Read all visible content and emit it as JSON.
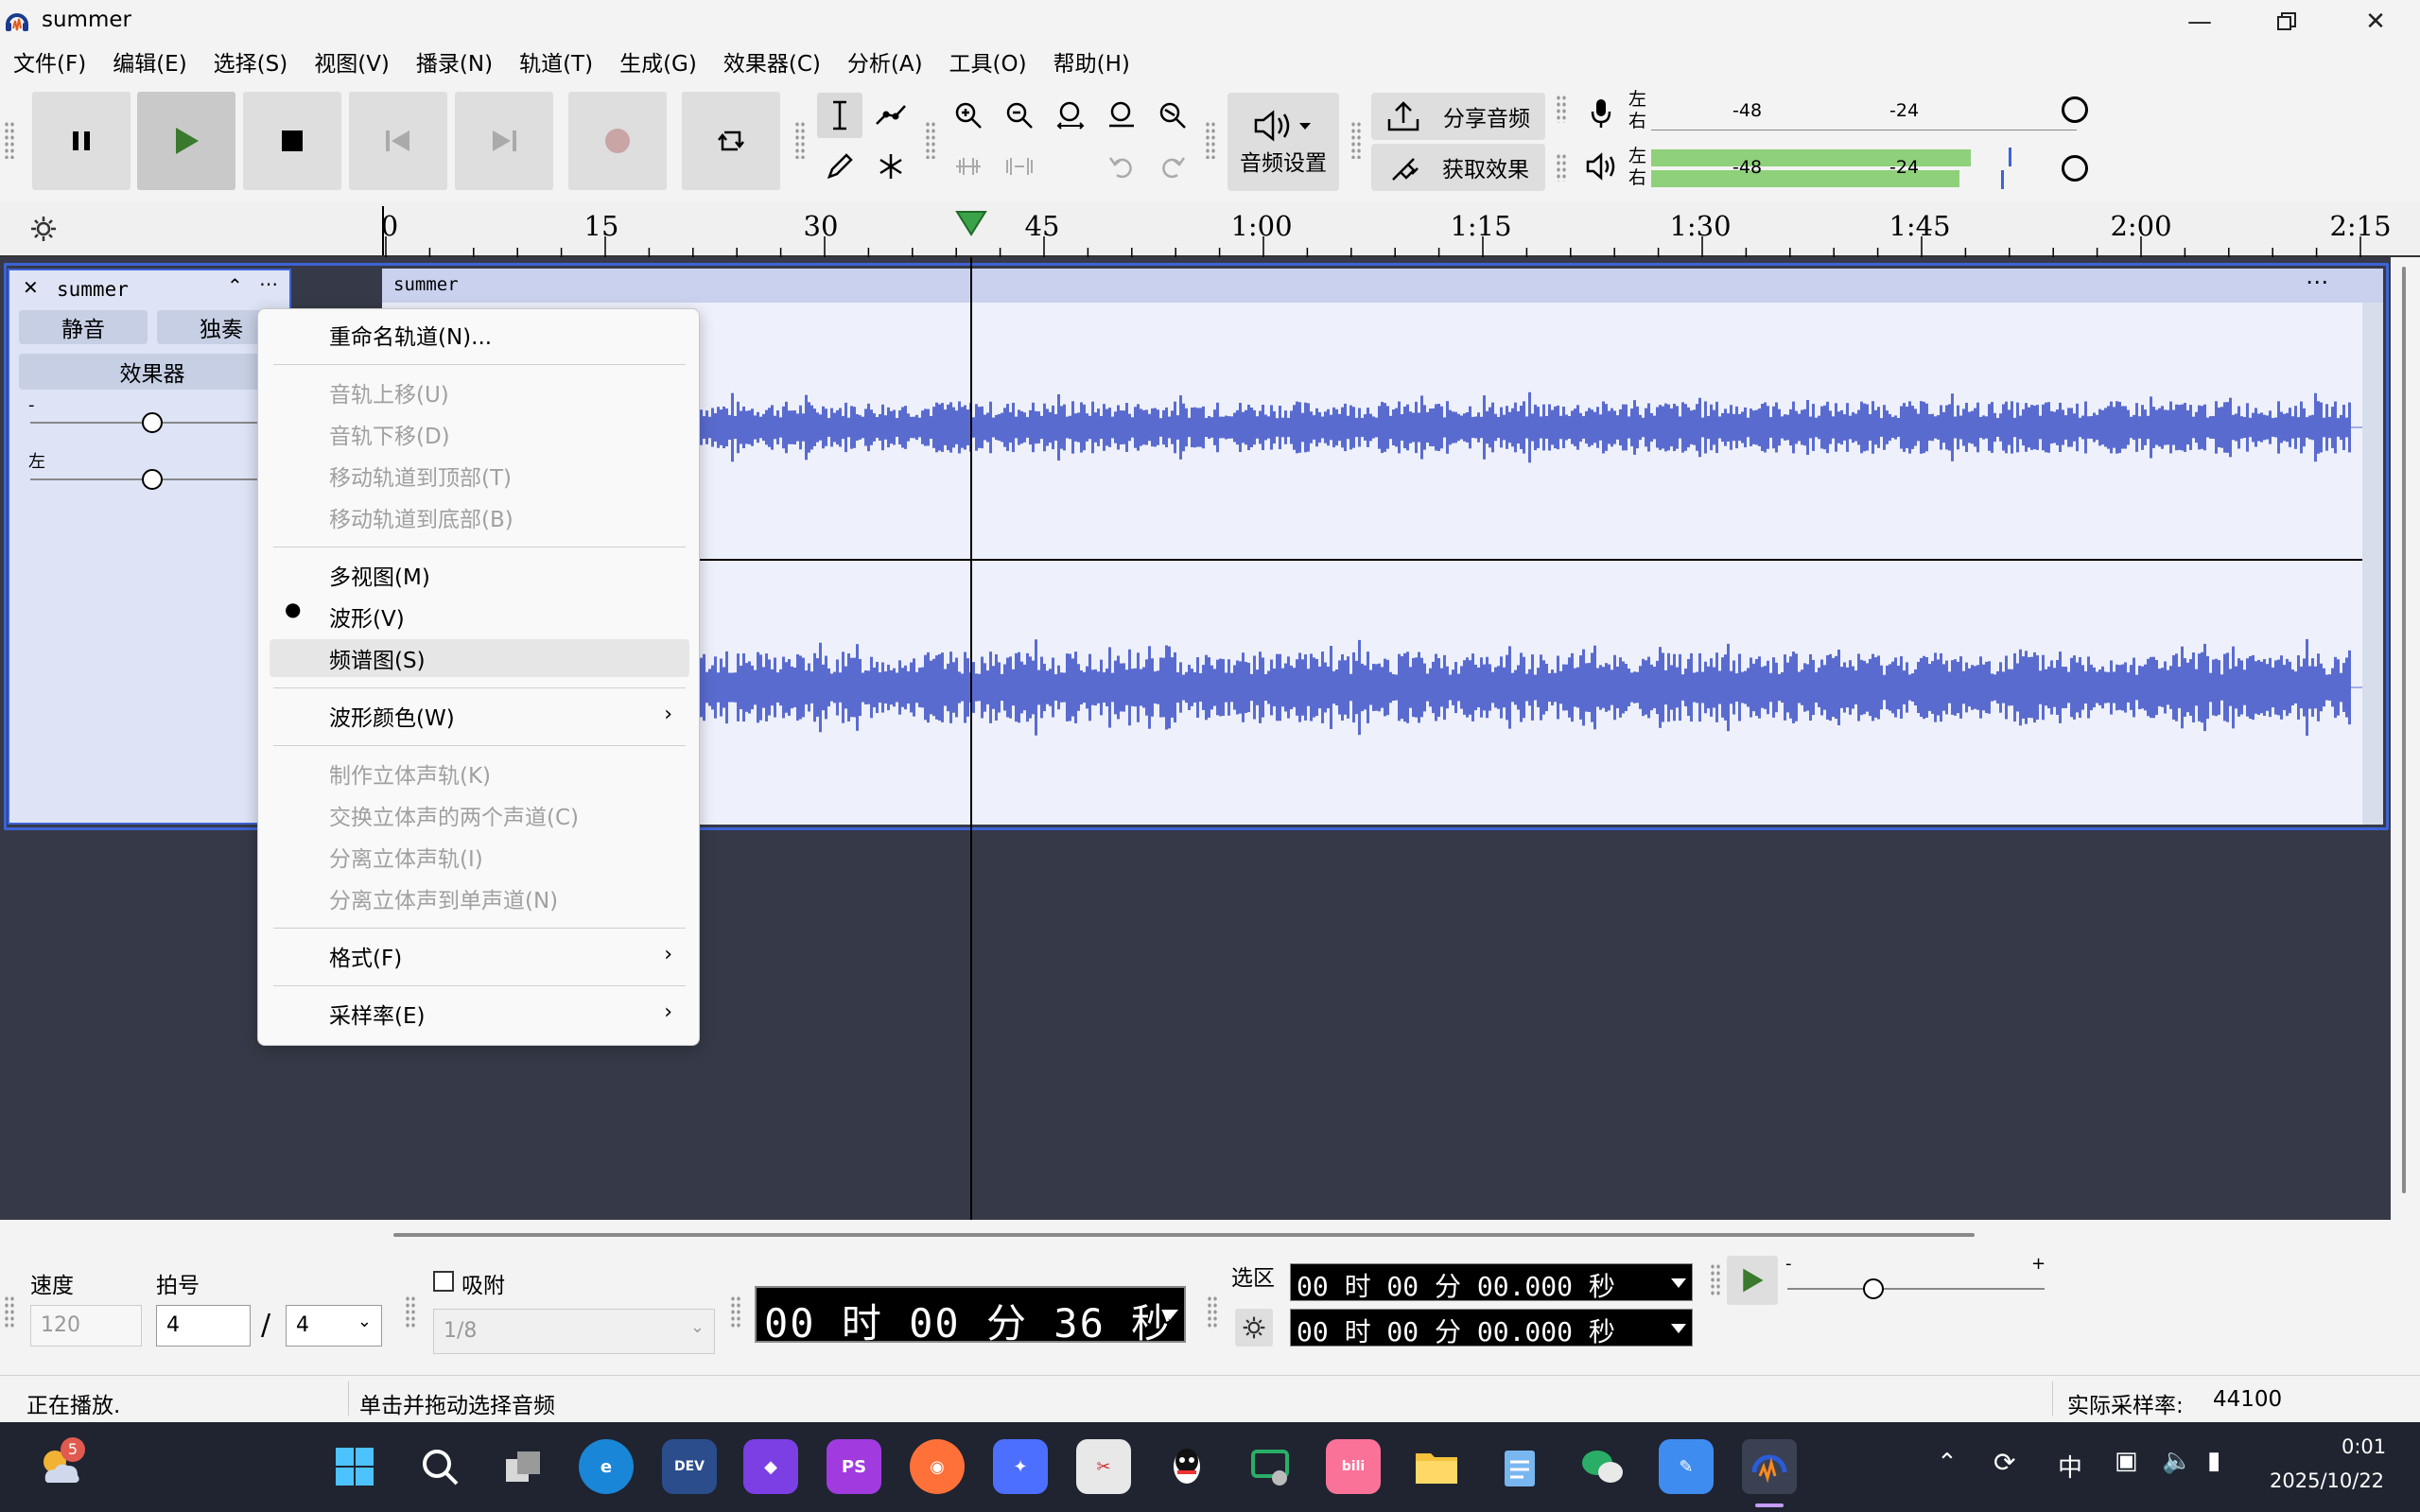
{
  "window": {
    "title": "summer"
  },
  "menu": [
    "文件(F)",
    "编辑(E)",
    "选择(S)",
    "视图(V)",
    "播录(N)",
    "轨道(T)",
    "生成(G)",
    "效果器(C)",
    "分析(A)",
    "工具(O)",
    "帮助(H)"
  ],
  "toolbar": {
    "audio_setup": "音频设置",
    "share_audio": "分享音频",
    "get_effects": "获取效果",
    "meter_rec_left": "左",
    "meter_rec_right": "右",
    "meter_play_left": "左",
    "meter_play_right": "右",
    "meter_tick_48": "-48",
    "meter_tick_24": "-24",
    "meter_play_tick_48": "-48",
    "meter_play_tick_24": "-24"
  },
  "ruler": {
    "ticks": [
      "0",
      "15",
      "30",
      "45",
      "1:00",
      "1:15",
      "1:30",
      "1:45",
      "2:00",
      "2:15"
    ]
  },
  "track": {
    "name": "summer",
    "mute": "静音",
    "solo": "独奏",
    "effects": "效果器",
    "gain_minus": "-",
    "pan_left": "左",
    "clip_name": "summer"
  },
  "context_menu": {
    "rename": "重命名轨道(N)...",
    "move_up": "音轨上移(U)",
    "move_down": "音轨下移(D)",
    "move_top": "移动轨道到顶部(T)",
    "move_bottom": "移动轨道到底部(B)",
    "multi_view": "多视图(M)",
    "waveform": "波形(V)",
    "spectrogram": "频谱图(S)",
    "wave_color": "波形颜色(W)",
    "make_stereo": "制作立体声轨(K)",
    "swap_channels": "交换立体声的两个声道(C)",
    "split_stereo": "分离立体声轨(I)",
    "split_mono": "分离立体声到单声道(N)",
    "format": "格式(F)",
    "rate": "采样率(E)"
  },
  "bottom": {
    "tempo_label": "速度",
    "tempo_value": "120",
    "meter_label": "拍号",
    "meter_num": "4",
    "meter_slash": "/",
    "meter_den": "4",
    "snap_label": "吸附",
    "snap_value": "1/8",
    "time": "00 时 00 分 36 秒",
    "selection_label": "选区",
    "sel_start": "00 时 00 分 00.000 秒",
    "sel_end": "00 时 00 分 00.000 秒",
    "speed_minus": "-",
    "speed_plus": "+"
  },
  "status": {
    "left": "正在播放.",
    "middle": "单击并拖动选择音频",
    "rate_label": "实际采样率:",
    "rate_value": "44100"
  },
  "taskbar": {
    "weather_badge": "5",
    "clock_time": "0:01",
    "clock_date": "2025/10/22",
    "ime": "中",
    "icons": [
      "start-icon",
      "search-icon",
      "task-view-icon",
      "edge-icon",
      "devc-icon",
      "jetbrains-icon",
      "phpstorm-icon",
      "firefox-icon",
      "app-icon",
      "snip-icon",
      "qq-icon",
      "wechat-dev-icon",
      "bilibili-icon",
      "folder-icon",
      "notepad-icon",
      "wechat-icon",
      "pen-icon",
      "audacity-icon"
    ]
  },
  "colors": {
    "accent": "#3d63d6",
    "waveform": "#5a6bd0",
    "track_bg": "#363a48",
    "meter_green": "#8fd07a"
  }
}
